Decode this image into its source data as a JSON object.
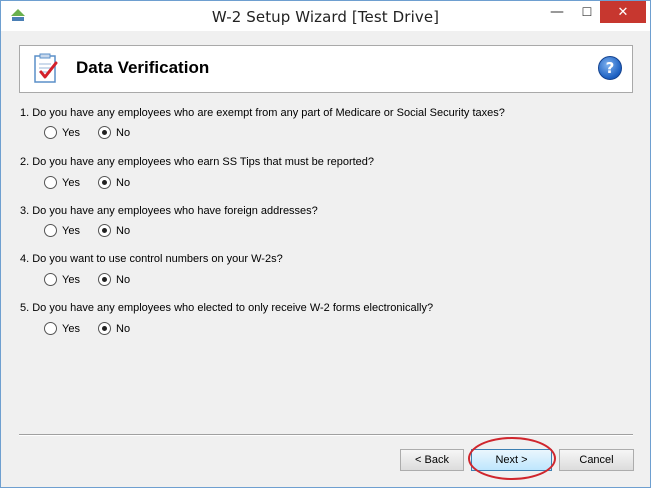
{
  "window": {
    "title": "W-2 Setup Wizard [Test Drive]",
    "controls": {
      "minimize": "—",
      "maximize": "☐",
      "close": "✕"
    }
  },
  "header": {
    "title": "Data Verification",
    "icon": "checklist-icon",
    "help_icon": "help-icon",
    "help_glyph": "?"
  },
  "questions": [
    {
      "text": "1. Do you have any employees who are exempt from any part of Medicare or Social Security taxes?",
      "yes_label": "Yes",
      "no_label": "No",
      "selected": "No"
    },
    {
      "text": "2. Do you have any employees who earn SS Tips that must be reported?",
      "yes_label": "Yes",
      "no_label": "No",
      "selected": "No"
    },
    {
      "text": "3. Do you have any employees who have foreign addresses?",
      "yes_label": "Yes",
      "no_label": "No",
      "selected": "No"
    },
    {
      "text": "4. Do you want to use control numbers on your W-2s?",
      "yes_label": "Yes",
      "no_label": "No",
      "selected": "No"
    },
    {
      "text": "5. Do you have any employees who elected to only receive W-2 forms electronically?",
      "yes_label": "Yes",
      "no_label": "No",
      "selected": "No"
    }
  ],
  "footer": {
    "back_label": "< Back",
    "next_label": "Next >",
    "cancel_label": "Cancel"
  },
  "colors": {
    "close_button": "#c7372f",
    "highlight_ring": "#d0262d",
    "window_bg": "#f0f0f0"
  }
}
